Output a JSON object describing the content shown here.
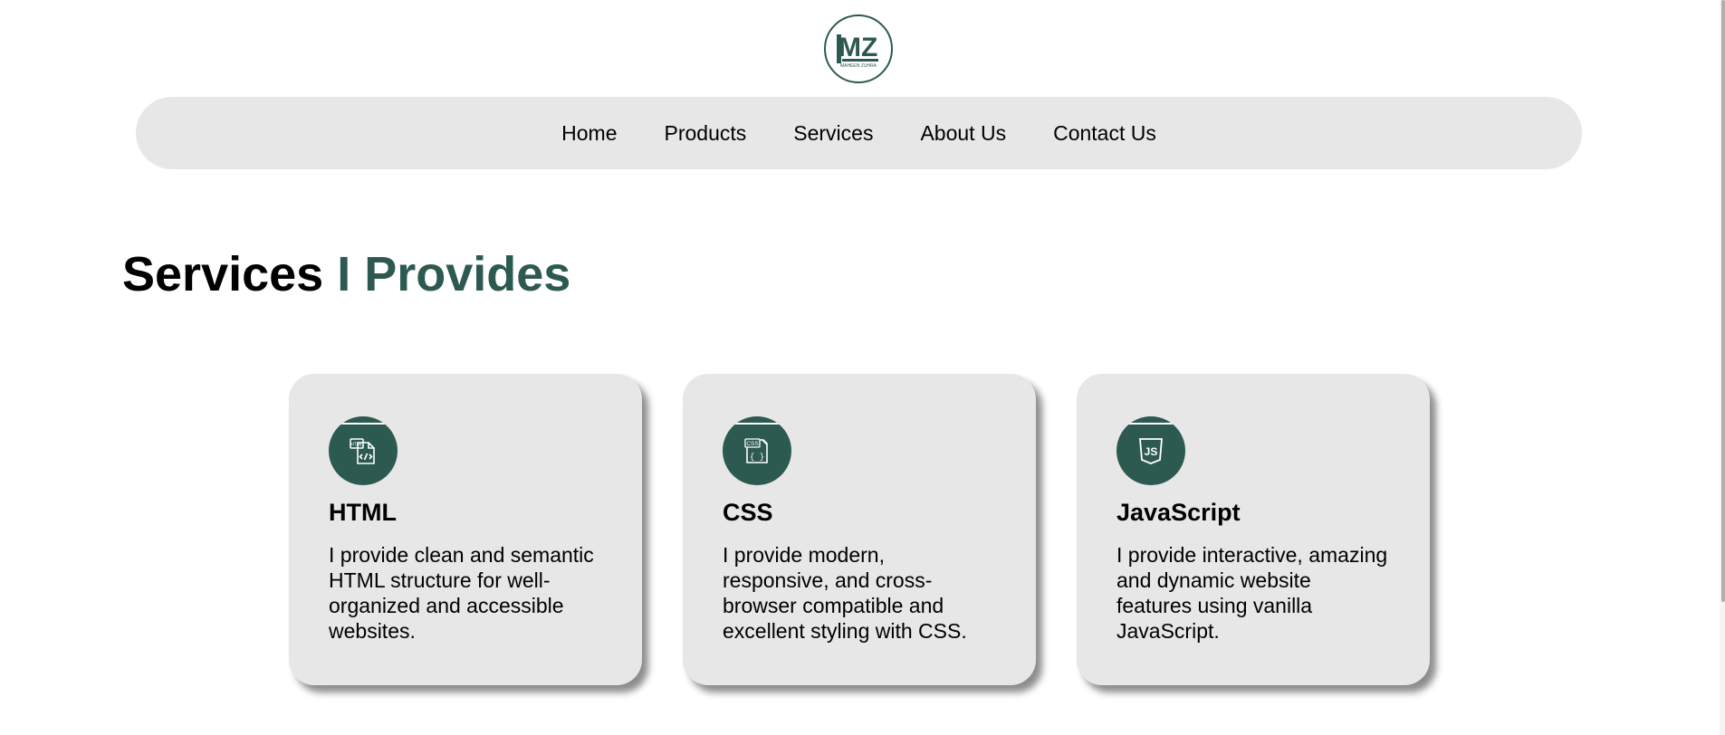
{
  "logo": {
    "monogram": "MZ",
    "name": "MAHEEN ZUHRA",
    "icon": "mz-logo-icon"
  },
  "nav": {
    "items": [
      {
        "label": "Home"
      },
      {
        "label": "Products"
      },
      {
        "label": "Services"
      },
      {
        "label": "About Us"
      },
      {
        "label": "Contact Us"
      }
    ]
  },
  "section": {
    "title_main": "Services",
    "title_accent": "I Provides"
  },
  "cards": [
    {
      "icon": "html-file-icon",
      "title": "HTML",
      "text": "I provide clean and semantic HTML structure for well-organized and accessible websites."
    },
    {
      "icon": "css-file-icon",
      "title": "CSS",
      "text": "I provide modern, responsive, and cross-browser compatible and excellent styling with CSS."
    },
    {
      "icon": "javascript-shield-icon",
      "title": "JavaScript",
      "text": "I provide interactive, amazing and dynamic website features using vanilla JavaScript."
    }
  ],
  "colors": {
    "accent": "#2d5a50",
    "card_bg": "#e7e7e7",
    "nav_bg": "#e7e7e7"
  }
}
